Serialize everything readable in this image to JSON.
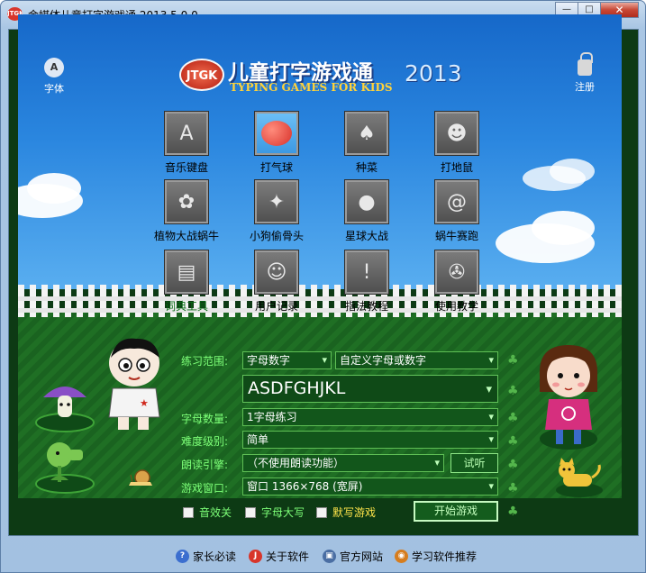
{
  "window": {
    "title": "金媒体儿童打字游戏通 2013.5.0.0",
    "app_icon_text": "JTGK",
    "controls": {
      "minimize": "—",
      "maximize": "□",
      "close": "✕"
    }
  },
  "header": {
    "font_label": "字体",
    "font_icon_glyph": "A",
    "register_label": "注册",
    "logo_badge": "JTGK",
    "logo_title": "儿童打字游戏通",
    "logo_year": "2013",
    "logo_subtitle": "TYPING GAMES FOR KIDS"
  },
  "games": [
    {
      "label": "音乐键盘",
      "icon": "music-keyboard-icon",
      "glyph": "A"
    },
    {
      "label": "打气球",
      "icon": "balloon-icon",
      "glyph": ""
    },
    {
      "label": "种菜",
      "icon": "mushroom-icon",
      "glyph": "♠"
    },
    {
      "label": "打地鼠",
      "icon": "mole-icon",
      "glyph": "☻"
    },
    {
      "label": "植物大战蜗牛",
      "icon": "plant-vs-snail-icon",
      "glyph": "✿"
    },
    {
      "label": "小狗偷骨头",
      "icon": "dog-bone-icon",
      "glyph": "✦"
    },
    {
      "label": "星球大战",
      "icon": "planet-icon",
      "glyph": "●"
    },
    {
      "label": "蜗牛赛跑",
      "icon": "snail-race-icon",
      "glyph": "@"
    },
    {
      "label": "词典工具",
      "icon": "dictionary-icon",
      "glyph": "▤"
    },
    {
      "label": "用户记录",
      "icon": "user-record-icon",
      "glyph": "☺"
    },
    {
      "label": "指法教程",
      "icon": "fingering-tutorial-icon",
      "glyph": "!"
    },
    {
      "label": "使用教学",
      "icon": "film-reel-icon",
      "glyph": "✇"
    }
  ],
  "settings": {
    "practice_range": {
      "label": "练习范围:",
      "value": "字母数字",
      "custom_value": "自定义字母或数字"
    },
    "preview_text": "ASDFGHJKL",
    "letter_count": {
      "label": "字母数量:",
      "value": "1字母练习"
    },
    "difficulty": {
      "label": "难度级别:",
      "value": "简单"
    },
    "tts_engine": {
      "label": "朗读引擎:",
      "value": "（不使用朗读功能）",
      "test_button": "试听"
    },
    "game_window": {
      "label": "游戏窗口:",
      "value": "窗口 1366×768 (宽屏)"
    },
    "sound_effects": {
      "label": "音效关",
      "checked": false
    },
    "uppercase": {
      "label": "字母大写",
      "checked": false
    },
    "dictation": {
      "label": "默写游戏",
      "checked": false
    },
    "start_button": "开始游戏"
  },
  "footer": {
    "links": [
      {
        "label": "家长必读",
        "icon": "question-icon",
        "glyph": "?",
        "color": "#3b6ecf"
      },
      {
        "label": "关于软件",
        "icon": "jtgk-logo-icon",
        "glyph": "J",
        "color": "#d8352a"
      },
      {
        "label": "官方网站",
        "icon": "website-icon",
        "glyph": "▣",
        "color": "#4a6ea3"
      },
      {
        "label": "学习软件推荐",
        "icon": "recommend-icon",
        "glyph": "◉",
        "color": "#d67d1e"
      }
    ]
  }
}
